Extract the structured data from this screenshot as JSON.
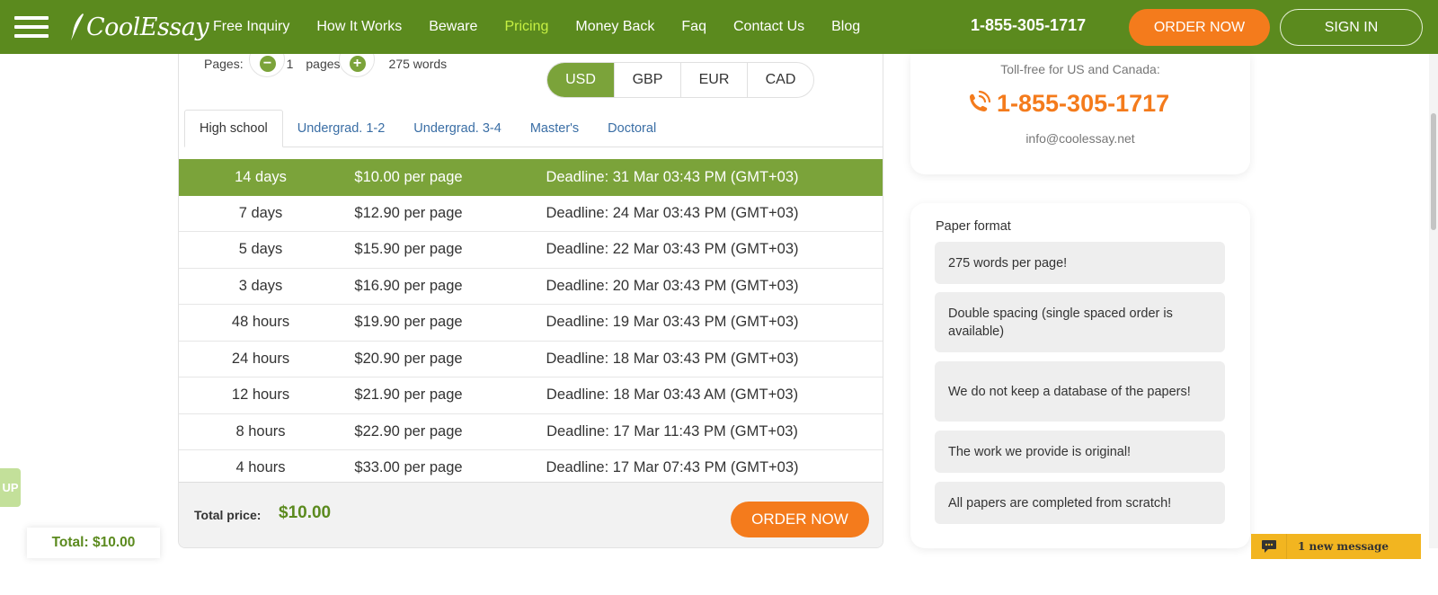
{
  "header": {
    "logo": "CoolEssay",
    "nav": [
      "Free Inquiry",
      "How It Works",
      "Beware",
      "Pricing",
      "Money Back",
      "Faq",
      "Contact Us",
      "Blog"
    ],
    "active_nav": "Pricing",
    "phone": "1-855-305-1717",
    "order_label": "ORDER NOW",
    "signin_label": "SIGN IN"
  },
  "calculator": {
    "pages_label": "Pages:",
    "pages_value": "1",
    "pages_unit": "pages",
    "words": "275 words",
    "currencies": [
      "USD",
      "GBP",
      "EUR",
      "CAD"
    ],
    "active_currency": "USD",
    "levels": [
      "High school",
      "Undergrad. 1-2",
      "Undergrad. 3-4",
      "Master's",
      "Doctoral"
    ],
    "active_level": "High school",
    "rows": [
      {
        "duration": "14 days",
        "price": "$10.00 per page",
        "deadline": "Deadline: 31 Mar 03:43 PM (GMT+03)",
        "active": true
      },
      {
        "duration": "7 days",
        "price": "$12.90 per page",
        "deadline": "Deadline: 24 Mar 03:43 PM (GMT+03)"
      },
      {
        "duration": "5 days",
        "price": "$15.90 per page",
        "deadline": "Deadline: 22 Mar 03:43 PM (GMT+03)"
      },
      {
        "duration": "3 days",
        "price": "$16.90 per page",
        "deadline": "Deadline: 20 Mar 03:43 PM (GMT+03)"
      },
      {
        "duration": "48 hours",
        "price": "$19.90 per page",
        "deadline": "Deadline: 19 Mar 03:43 PM (GMT+03)"
      },
      {
        "duration": "24 hours",
        "price": "$20.90 per page",
        "deadline": "Deadline: 18 Mar 03:43 PM (GMT+03)"
      },
      {
        "duration": "12 hours",
        "price": "$21.90 per page",
        "deadline": "Deadline: 18 Mar 03:43 AM (GMT+03)"
      },
      {
        "duration": "8 hours",
        "price": "$22.90 per page",
        "deadline": "Deadline: 17 Mar 11:43 PM (GMT+03)"
      },
      {
        "duration": "4 hours",
        "price": "$33.00 per page",
        "deadline": "Deadline: 17 Mar 07:43 PM (GMT+03)"
      }
    ],
    "total_label": "Total price:",
    "total_value": "$10.00",
    "order_label": "ORDER NOW"
  },
  "contact": {
    "toll_free": "Toll-free for US and Canada:",
    "phone": "1-855-305-1717",
    "email": "info@coolessay.net"
  },
  "paper_format": {
    "title": "Paper format",
    "items": [
      "275 words per page!",
      "Double spacing (single spaced order is available)",
      "We do not keep a database of the papers!",
      "The work we provide is original!",
      "All papers are completed from scratch!"
    ]
  },
  "floating": {
    "up_label": "UP",
    "sticky_total": "Total: $10.00",
    "chat_label": "1 new message"
  },
  "colors": {
    "header_green": "#5b8a1e",
    "row_green": "#7ba33a",
    "accent_orange": "#f47b1c",
    "active_nav": "#c6f043",
    "chat_yellow": "#f2b520"
  }
}
